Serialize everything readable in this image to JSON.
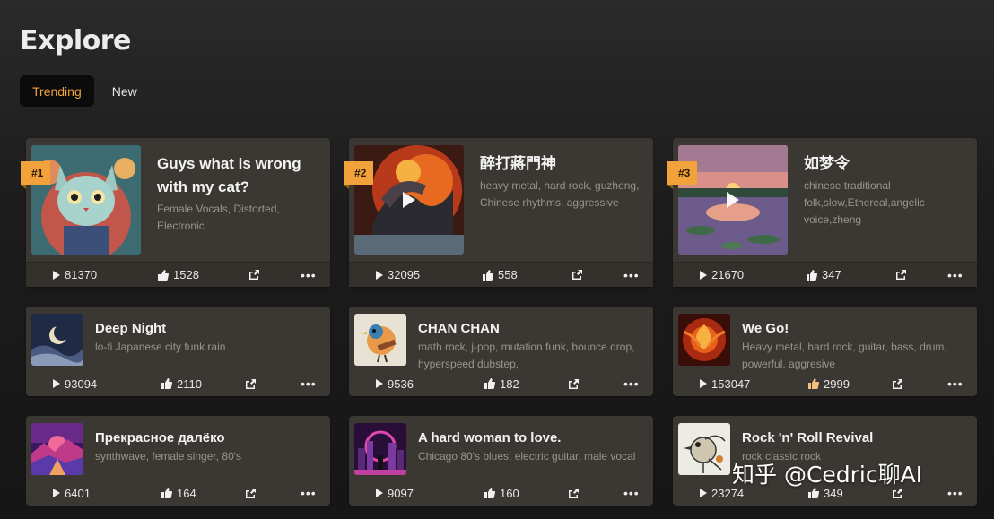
{
  "page": {
    "title": "Explore"
  },
  "tabs": [
    {
      "label": "Trending",
      "active": true
    },
    {
      "label": "New",
      "active": false
    }
  ],
  "featured": [
    {
      "rank": "#1",
      "title": "Guys what is wrong with my cat?",
      "tags": "Female Vocals, Distorted, Electronic",
      "plays": "81370",
      "likes": "1528",
      "icon": "cat-artwork"
    },
    {
      "rank": "#2",
      "title": "醉打蔣門神",
      "tags": "heavy metal, hard rock, guzheng, Chinese rhythms, aggressive",
      "plays": "32095",
      "likes": "558",
      "icon": "dragon-artwork"
    },
    {
      "rank": "#3",
      "title": "如梦令",
      "tags": "chinese traditional folk,slow,Ethereal,angelic voice,zheng",
      "plays": "21670",
      "likes": "347",
      "icon": "lake-sunset-artwork"
    }
  ],
  "songs": [
    {
      "title": "Deep Night",
      "tags": "lo-fi Japanese city funk rain",
      "plays": "93094",
      "likes": "2110",
      "icon": "moon-night-artwork"
    },
    {
      "title": "CHAN CHAN",
      "tags": "math rock, j-pop, mutation funk, bounce drop, hyperspeed dubstep,",
      "plays": "9536",
      "likes": "182",
      "icon": "bird-guitar-artwork"
    },
    {
      "title": "We Go!",
      "tags": "Heavy metal, hard rock, guitar, bass, drum, powerful, aggresive",
      "plays": "153047",
      "likes": "2999",
      "icon": "phoenix-artwork"
    },
    {
      "title": "Прекрасное далёко",
      "tags": "synthwave, female singer, 80's",
      "plays": "6401",
      "likes": "164",
      "icon": "synthwave-artwork"
    },
    {
      "title": "A hard woman to love.",
      "tags": "Chicago 80's blues, electric guitar, male vocal",
      "plays": "9097",
      "likes": "160",
      "icon": "neon-city-artwork"
    },
    {
      "title": "Rock 'n' Roll Revival",
      "tags": "rock classic rock",
      "plays": "23274",
      "likes": "349",
      "icon": "sketch-bird-artwork"
    }
  ],
  "watermark": "知乎 @Cedric聊AI",
  "colors": {
    "accent": "#f2a23a",
    "card": "#3b3733",
    "background": "#1c1c1c"
  }
}
